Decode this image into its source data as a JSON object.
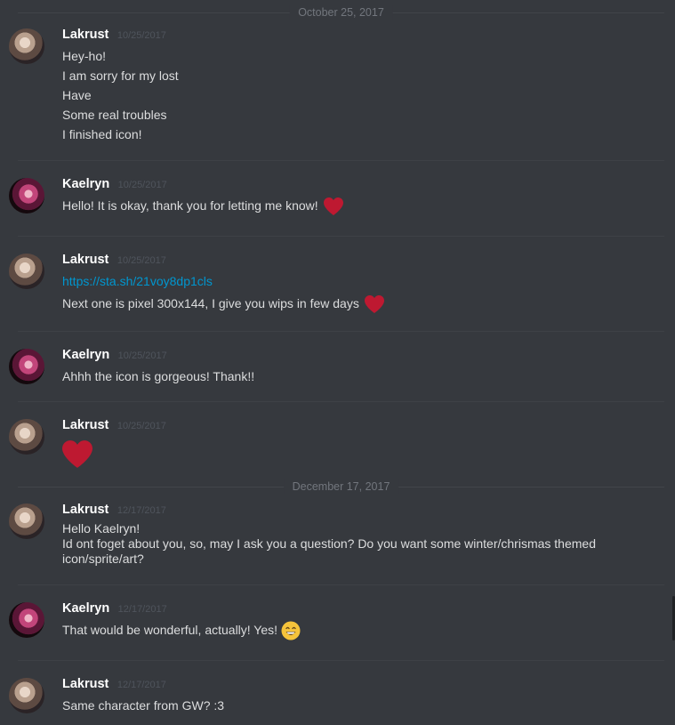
{
  "dividers": [
    "October 25, 2017",
    "December 17, 2017"
  ],
  "messages": [
    {
      "user": "Lakrust",
      "time": "10/25/2017",
      "lines": [
        "Hey-ho!",
        "I am sorry for my lost",
        "Have",
        "Some real troubles",
        "I finished icon!"
      ]
    },
    {
      "user": "Kaelryn",
      "time": "10/25/2017",
      "lines": [
        "Hello! It is okay, thank you for letting me know!"
      ]
    },
    {
      "user": "Lakrust",
      "time": "10/25/2017",
      "link": "https://sta.sh/21voy8dp1cls",
      "lines": [
        "Next one is pixel 300x144, I give you wips in few days"
      ]
    },
    {
      "user": "Kaelryn",
      "time": "10/25/2017",
      "lines": [
        "Ahhh the icon is gorgeous! Thank!!"
      ]
    },
    {
      "user": "Lakrust",
      "time": "10/25/2017",
      "lines": []
    },
    {
      "user": "Lakrust",
      "time": "12/17/2017",
      "lines": [
        "Hello Kaelryn!",
        "Id ont foget about you, so, may I ask you a question? Do you want some winter/chrismas themed",
        "icon/sprite/art?"
      ]
    },
    {
      "user": "Kaelryn",
      "time": "12/17/2017",
      "lines": [
        "That would be wonderful, actually! Yes!"
      ]
    },
    {
      "user": "Lakrust",
      "time": "12/17/2017",
      "lines": [
        "Same character from GW? :3"
      ]
    }
  ],
  "icons": {
    "heart": "red-heart-icon",
    "grin": "grinning-face-icon"
  },
  "colors": {
    "background": "#36393e",
    "link": "#0096cf",
    "heart": "#be1931",
    "emoji": "#f5c33b"
  }
}
